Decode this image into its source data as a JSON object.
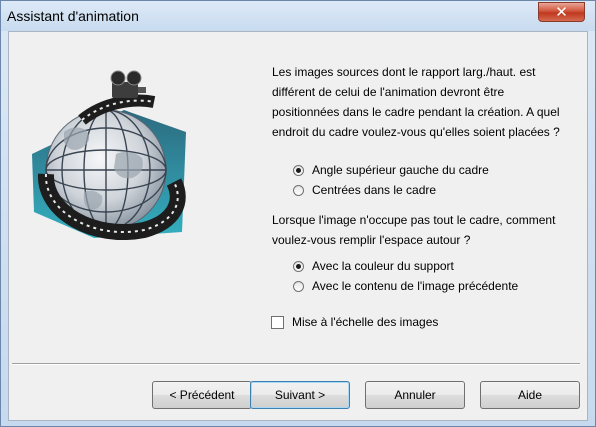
{
  "window": {
    "title": "Assistant d'animation"
  },
  "icons": {
    "close": "close-icon",
    "artwork": "globe-film-reel-icon"
  },
  "question1": {
    "text": "Les images sources dont le rapport larg./haut. est différent de celui de l'animation devront être positionnées dans le cadre pendant la création. A quel endroit du cadre voulez-vous qu'elles soient placées ?",
    "options": [
      {
        "label": "Angle supérieur gauche du cadre",
        "checked": true
      },
      {
        "label": "Centrées dans le cadre",
        "checked": false
      }
    ]
  },
  "question2": {
    "text": "Lorsque l'image n'occupe pas tout le cadre, comment voulez-vous remplir l'espace autour ?",
    "options": [
      {
        "label": "Avec la couleur du support",
        "checked": true
      },
      {
        "label": "Avec le contenu de l'image précédente",
        "checked": false
      }
    ]
  },
  "scale_checkbox": {
    "label": "Mise à l'échelle des images",
    "checked": false
  },
  "buttons": {
    "previous": "< Précédent",
    "next": "Suivant >",
    "cancel": "Annuler",
    "help": "Aide"
  },
  "colors": {
    "dialog_bg": "#f0f0f0",
    "close_button": "#c7432a",
    "frame": "#c6d9ee"
  }
}
